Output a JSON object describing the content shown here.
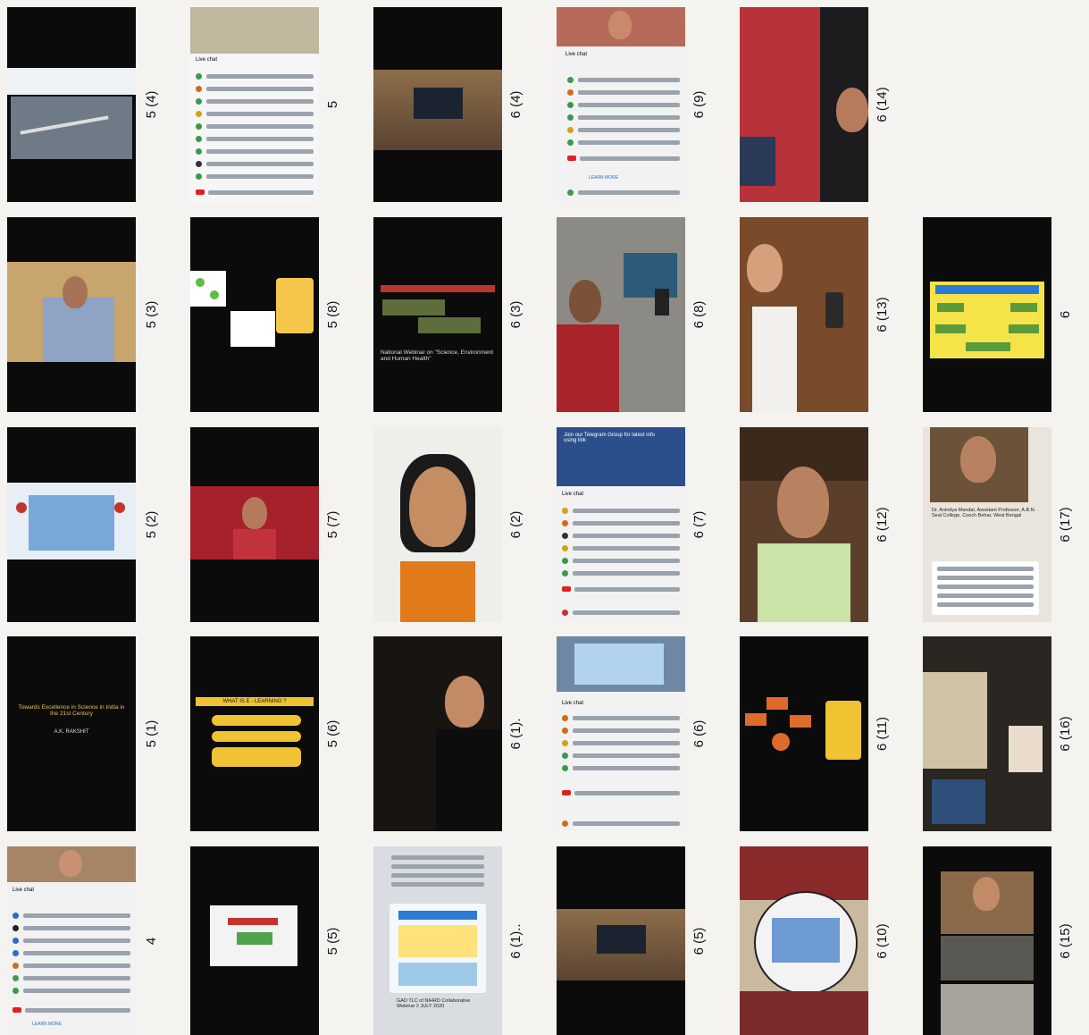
{
  "labels": {
    "r1c1": "5 (4)",
    "r1c2": "5",
    "r1c3": "6 (4)",
    "r1c4": "6 (9)",
    "r1c5": "6 (14)",
    "r2c1": "5 (3)",
    "r2c2": "5 (8)",
    "r2c3": "6 (3)",
    "r2c4": "6 (8)",
    "r2c5": "6 (13)",
    "r2c6": "6",
    "r3c1": "5 (2)",
    "r3c2": "5 (7)",
    "r3c3": "6 (2)",
    "r3c4": "6 (7)",
    "r3c5": "6 (12)",
    "r3c6": "6 (17)",
    "r4c1": "5 (1)",
    "r4c2": "5 (6)",
    "r4c3": "6 (1).",
    "r4c4": "6 (6)",
    "r4c5": "6 (11)",
    "r4c6": "6 (16)",
    "r5c1": "4",
    "r5c2": "5 (5)",
    "r5c3": "6 (1)..",
    "r5c4": "6 (5)",
    "r5c5": "6 (10)",
    "r5c6": "6 (15)"
  },
  "screens": {
    "r1c2_chat": "Live chat",
    "r1c4_chat": "Live chat",
    "r1c4_learn": "LEARN MORE",
    "r2c3_title": "National Webinar on \"Science, Environment and Human Health\"",
    "r3c4_banner": "Join our Telegram Group for latest info using link",
    "r3c4_chat": "Live chat",
    "r3c6_name": "Dr. Anindya Mandal, Assistant Professor, A.B.N. Seal College, Cooch Behar, West Bengal",
    "r4c1_title": "Towards Excellence in Science in India in the 21st Century",
    "r4c1_author": "A.K. RAKSHIT",
    "r4c2_title": "WHAT IS E - LEARNING ?",
    "r4c4_chat": "Live chat",
    "r5c1_chat": "Live chat",
    "r5c1_learn": "LEARN MORE",
    "r5c3_caption": "GAD TLC of NIHRD Collaborative Webinar 2 JULY 2020"
  }
}
